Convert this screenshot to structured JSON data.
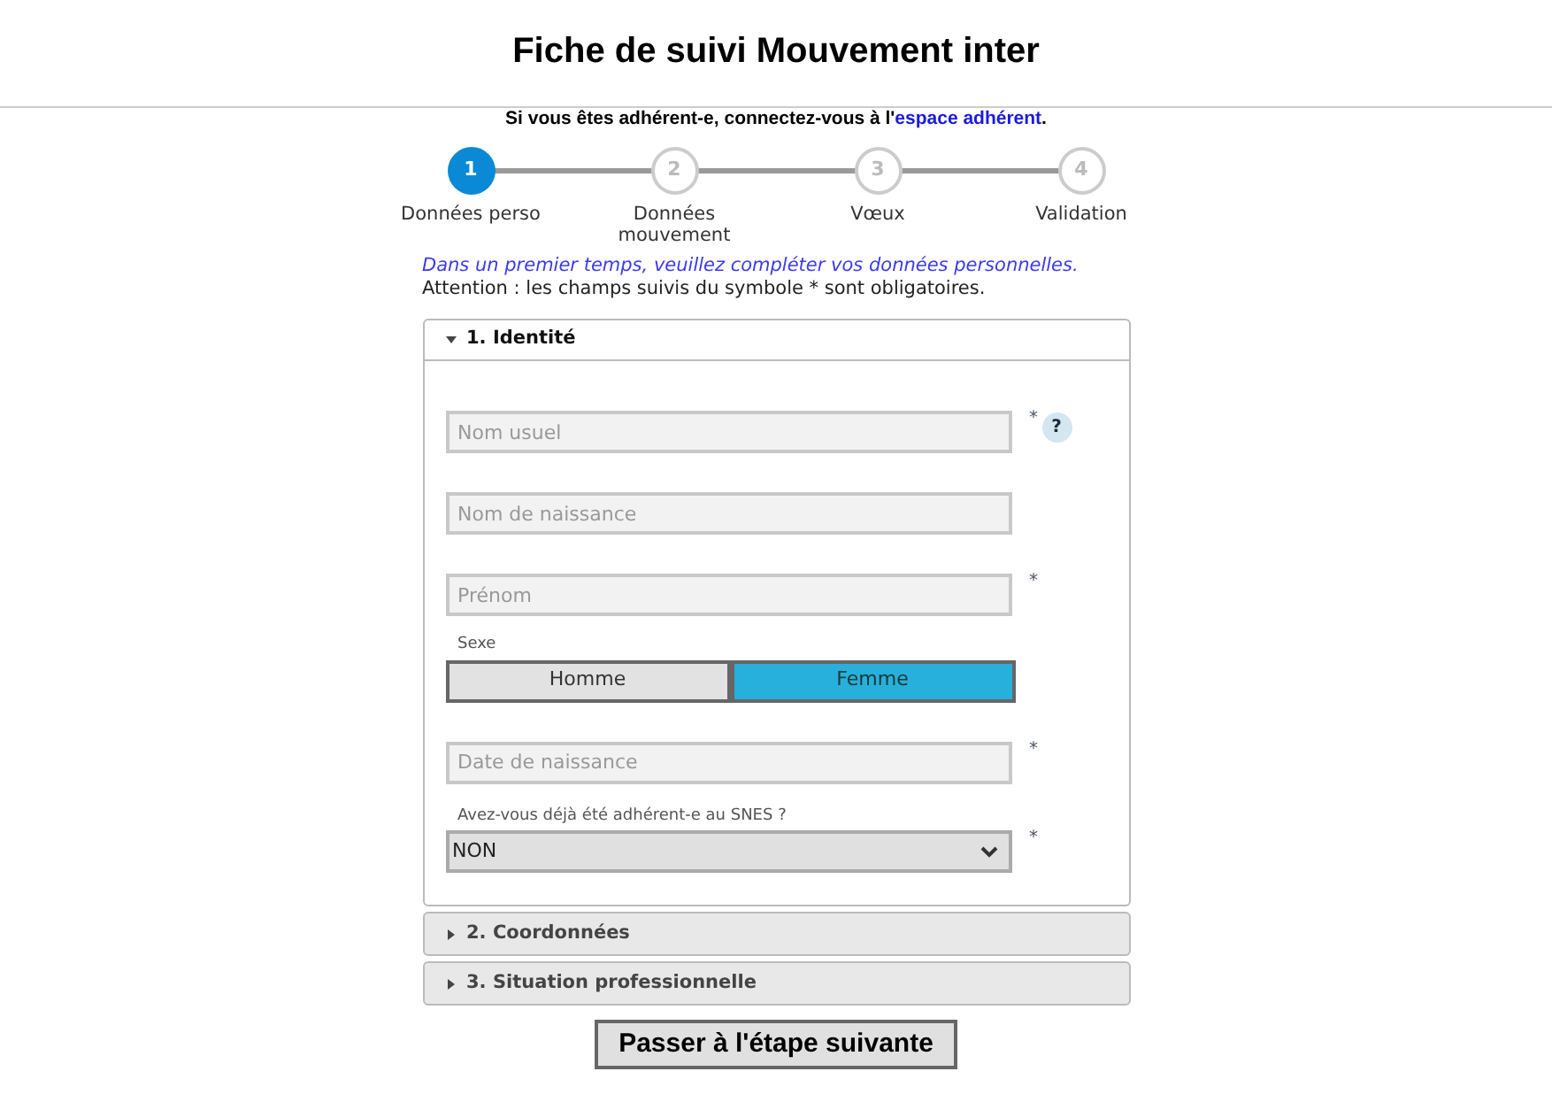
{
  "title": "Fiche de suivi Mouvement inter",
  "login_notice": {
    "before": "Si vous êtes adhérent-e, connectez-vous à l'",
    "link": "espace adhérent",
    "after": "."
  },
  "steps": [
    {
      "number": "1",
      "label": "Données perso",
      "selected": true
    },
    {
      "number": "2",
      "label": "Données mouvement",
      "selected": false
    },
    {
      "number": "3",
      "label": "Vœux",
      "selected": false
    },
    {
      "number": "4",
      "label": "Validation",
      "selected": false
    }
  ],
  "intro": "Dans un premier temps, veuillez compléter vos données personnelles.",
  "note": "Attention : les champs suivis du symbole * sont obligatoires.",
  "sections": [
    {
      "title": "1. Identité",
      "expanded": true,
      "fields": [
        {
          "kind": "input",
          "placeholder": "Nom usuel",
          "required": "*",
          "help": "?"
        },
        {
          "kind": "input",
          "placeholder": "Nom de naissance"
        },
        {
          "kind": "input",
          "placeholder": "Prénom",
          "required": "*"
        },
        {
          "kind": "toggle",
          "label": "Sexe",
          "options": [
            {
              "label": "Homme",
              "selected": false
            },
            {
              "label": "Femme",
              "selected": true
            }
          ]
        },
        {
          "kind": "input",
          "placeholder": "Date de naissance",
          "required": "*"
        },
        {
          "kind": "select",
          "label": "Avez-vous déjà été adhérent-e au SNES ?",
          "value": "NON",
          "required": "*"
        }
      ]
    },
    {
      "title": "2. Coordonnées",
      "expanded": false
    },
    {
      "title": "3. Situation professionnelle",
      "expanded": false
    }
  ],
  "next_button": "Passer à l'étape suivante"
}
